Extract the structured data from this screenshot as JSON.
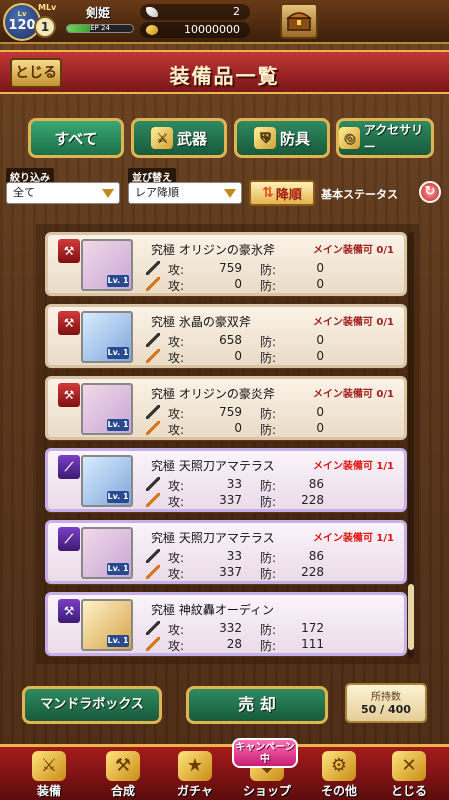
{
  "status": {
    "level_label": "Lv",
    "level": "120",
    "mlv_label": "MLv",
    "mlv": "1",
    "player_name": "剣姫",
    "exp_label": "EP",
    "exp_text": "24",
    "exp_fraction": 0.35,
    "gems": "2",
    "coins": "10000000"
  },
  "header": {
    "close_label": "とじる",
    "title": "装備品一覧"
  },
  "tabs": [
    {
      "label": "すべて",
      "icon": ""
    },
    {
      "label": "武器",
      "icon": "sword-icon"
    },
    {
      "label": "防具",
      "icon": "armor-icon"
    },
    {
      "label": "アクセサリー",
      "icon": "accessory-icon"
    }
  ],
  "filter": {
    "label": "絞り込み",
    "value": "全て"
  },
  "sort": {
    "label": "並び替え",
    "value": "レア降順",
    "direction_label": "降順"
  },
  "status_toggle": "基本ステータス",
  "items": [
    {
      "name": "究極 オリジンの豪氷斧",
      "equip_status": "メイン装備可 0/1",
      "atk1": "759",
      "def1": "0",
      "atk2": "0",
      "def2": "0",
      "lv": "Lv. 1"
    },
    {
      "name": "究極 氷晶の豪双斧",
      "equip_status": "メイン装備可 0/1",
      "atk1": "658",
      "def1": "0",
      "atk2": "0",
      "def2": "0",
      "lv": "Lv. 1"
    },
    {
      "name": "究極 オリジンの豪炎斧",
      "equip_status": "メイン装備可 0/1",
      "atk1": "759",
      "def1": "0",
      "atk2": "0",
      "def2": "0",
      "lv": "Lv. 1"
    },
    {
      "name": "究極 天照刀アマテラス",
      "equip_status": "メイン装備可 1/1",
      "atk1": "33",
      "def1": "86",
      "atk2": "337",
      "def2": "228",
      "lv": "Lv. 1"
    },
    {
      "name": "究極 天照刀アマテラス",
      "equip_status": "メイン装備可 1/1",
      "atk1": "33",
      "def1": "86",
      "atk2": "337",
      "def2": "228",
      "lv": "Lv. 1"
    },
    {
      "name": "究極 神紋轟オーディン",
      "equip_status": "",
      "atk1": "332",
      "def1": "172",
      "atk2": "28",
      "def2": "111",
      "lv": "Lv. 1"
    }
  ],
  "stat_labels": {
    "atk": "攻:",
    "def": "防:"
  },
  "actions": {
    "mandora_label": "マンドラボックス",
    "sell_label": "売 却",
    "possess_label": "所持数",
    "possess_value": "50 / 400"
  },
  "nav": [
    {
      "label": "装備",
      "icon": "equipment-icon"
    },
    {
      "label": "合成",
      "icon": "hammer-icon"
    },
    {
      "label": "ガチャ",
      "icon": "gacha-icon"
    },
    {
      "label": "ショップ",
      "icon": "shop-icon"
    },
    {
      "label": "その他",
      "icon": "gear-icon"
    },
    {
      "label": "とじる",
      "icon": "close-icon"
    }
  ],
  "campaign_badge": "キャンペーン中"
}
